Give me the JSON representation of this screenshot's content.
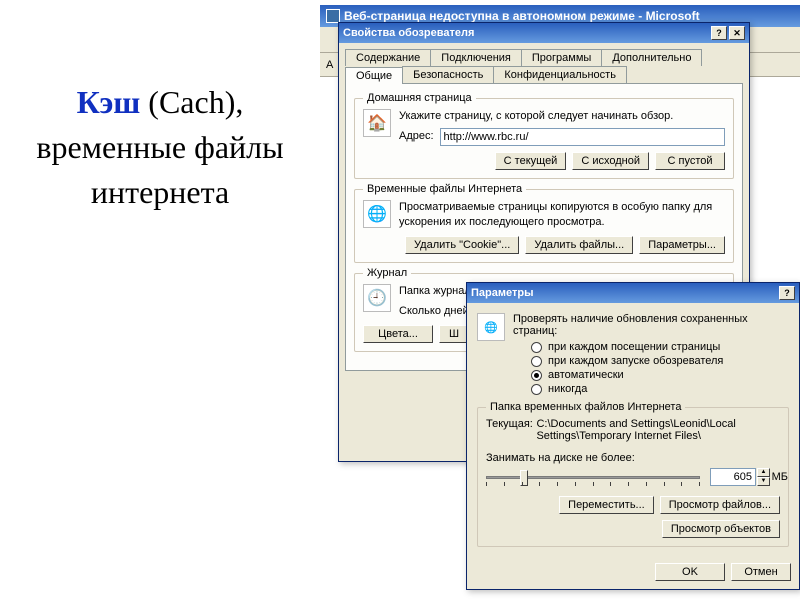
{
  "slide": {
    "keyword": "Кэш",
    "rest": " (Cach), временные файлы интернета"
  },
  "ie_window": {
    "title": "Веб-страница недоступна в автономном режиме - Microsoft",
    "addr_label": "А"
  },
  "internet_options": {
    "title": "Свойства обозревателя",
    "tabs_row1": [
      "Содержание",
      "Подключения",
      "Программы",
      "Дополнительно"
    ],
    "tabs_row2": [
      "Общие",
      "Безопасность",
      "Конфиденциальность"
    ],
    "active_tab": "Общие",
    "home": {
      "legend": "Домашняя страница",
      "desc": "Укажите страницу, с которой следует начинать обзор.",
      "addr_label": "Адрес:",
      "addr_value": "http://www.rbc.ru/",
      "btn_current": "С текущей",
      "btn_default": "С исходной",
      "btn_blank": "С пустой"
    },
    "temp": {
      "legend": "Временные файлы Интернета",
      "desc": "Просматриваемые страницы копируются в особую папку для ускорения их последующего просмотра.",
      "btn_cookie": "Удалить \"Cookie\"...",
      "btn_files": "Удалить файлы...",
      "btn_settings": "Параметры..."
    },
    "history": {
      "legend": "Журнал",
      "desc": "Папка журнала к страницам,",
      "days_label": "Сколько дней",
      "btn_colors": "Цвета...",
      "btn_fonts": "Ш"
    }
  },
  "settings": {
    "title": "Параметры",
    "check_label": "Проверять наличие обновления сохраненных страниц:",
    "radios": {
      "every_visit": "при каждом посещении страницы",
      "every_start": "при каждом запуске обозревателя",
      "auto": "автоматически",
      "never": "никогда"
    },
    "selected_radio": "auto",
    "folder": {
      "legend": "Папка временных файлов Интернета",
      "label": "Текущая:",
      "path": "C:\\Documents and Settings\\Leonid\\Local Settings\\Temporary Internet Files\\",
      "disk_label": "Занимать на диске не более:",
      "disk_value": "605",
      "disk_unit": "МБ",
      "btn_move": "Переместить...",
      "btn_view_files": "Просмотр файлов...",
      "btn_view_obj": "Просмотр объектов"
    },
    "btn_ok": "OK",
    "btn_cancel": "Отмен"
  }
}
